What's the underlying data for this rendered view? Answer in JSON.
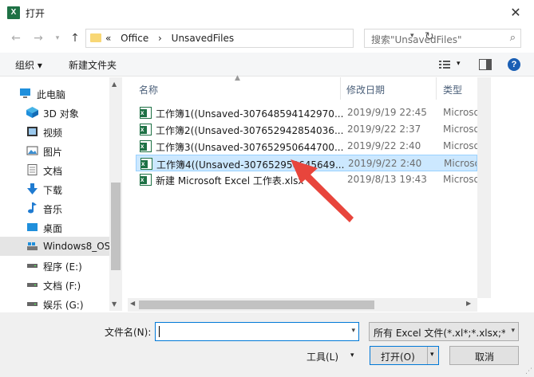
{
  "window": {
    "title": "打开",
    "app_icon": "excel-icon",
    "close_label": "✕"
  },
  "address": {
    "back_icon": "back-arrow-icon",
    "forward_icon": "forward-arrow-icon",
    "recent_icon": "chevron-down-icon",
    "up_icon": "up-arrow-icon",
    "crumbs": [
      "«",
      "Office",
      "›",
      "UnsavedFiles"
    ],
    "search_placeholder": "搜索\"UnsavedFiles\""
  },
  "command_bar": {
    "organize": "组织 ▾",
    "new_folder": "新建文件夹"
  },
  "nav": {
    "items": [
      {
        "label": "此电脑",
        "icon": "computer-icon"
      },
      {
        "label": "3D 对象",
        "icon": "3d-objects-icon"
      },
      {
        "label": "视频",
        "icon": "video-icon"
      },
      {
        "label": "图片",
        "icon": "picture-icon"
      },
      {
        "label": "文档",
        "icon": "document-icon"
      },
      {
        "label": "下载",
        "icon": "download-icon"
      },
      {
        "label": "音乐",
        "icon": "music-icon"
      },
      {
        "label": "桌面",
        "icon": "desktop-icon"
      },
      {
        "label": "Windows8_OS",
        "icon": "os-drive-icon"
      },
      {
        "label": "程序 (E:)",
        "icon": "drive-icon"
      },
      {
        "label": "文档 (F:)",
        "icon": "drive-icon"
      },
      {
        "label": "娱乐 (G:)",
        "icon": "drive-icon"
      }
    ],
    "selected_index": 8
  },
  "list": {
    "columns": [
      "名称",
      "修改日期",
      "类型"
    ],
    "rows": [
      {
        "name": "工作簿1((Unsaved-307648594142970...",
        "date": "2019/9/19 22:45",
        "type": "Microso"
      },
      {
        "name": "工作簿2((Unsaved-307652942854036...",
        "date": "2019/9/22 2:37",
        "type": "Microso"
      },
      {
        "name": "工作簿3((Unsaved-307652950644700...",
        "date": "2019/9/22 2:40",
        "type": "Microso"
      },
      {
        "name": "工作簿4((Unsaved-307652950645649...",
        "date": "2019/9/22 2:40",
        "type": "Microso"
      },
      {
        "name": "新建 Microsoft Excel 工作表.xlsx",
        "date": "2019/8/13 19:43",
        "type": "Microso"
      }
    ],
    "selected_index": 3
  },
  "bottom": {
    "filename_label": "文件名(N):",
    "filename_value": "",
    "filetype": "所有 Excel 文件(*.xl*;*.xlsx;*.xl",
    "tools": "工具(L)",
    "open": "打开(O)",
    "cancel": "取消"
  },
  "colors": {
    "accent": "#0078d7",
    "selection": "#cce8ff",
    "excel_green": "#1e7145",
    "annotation_arrow": "#e8453c"
  }
}
